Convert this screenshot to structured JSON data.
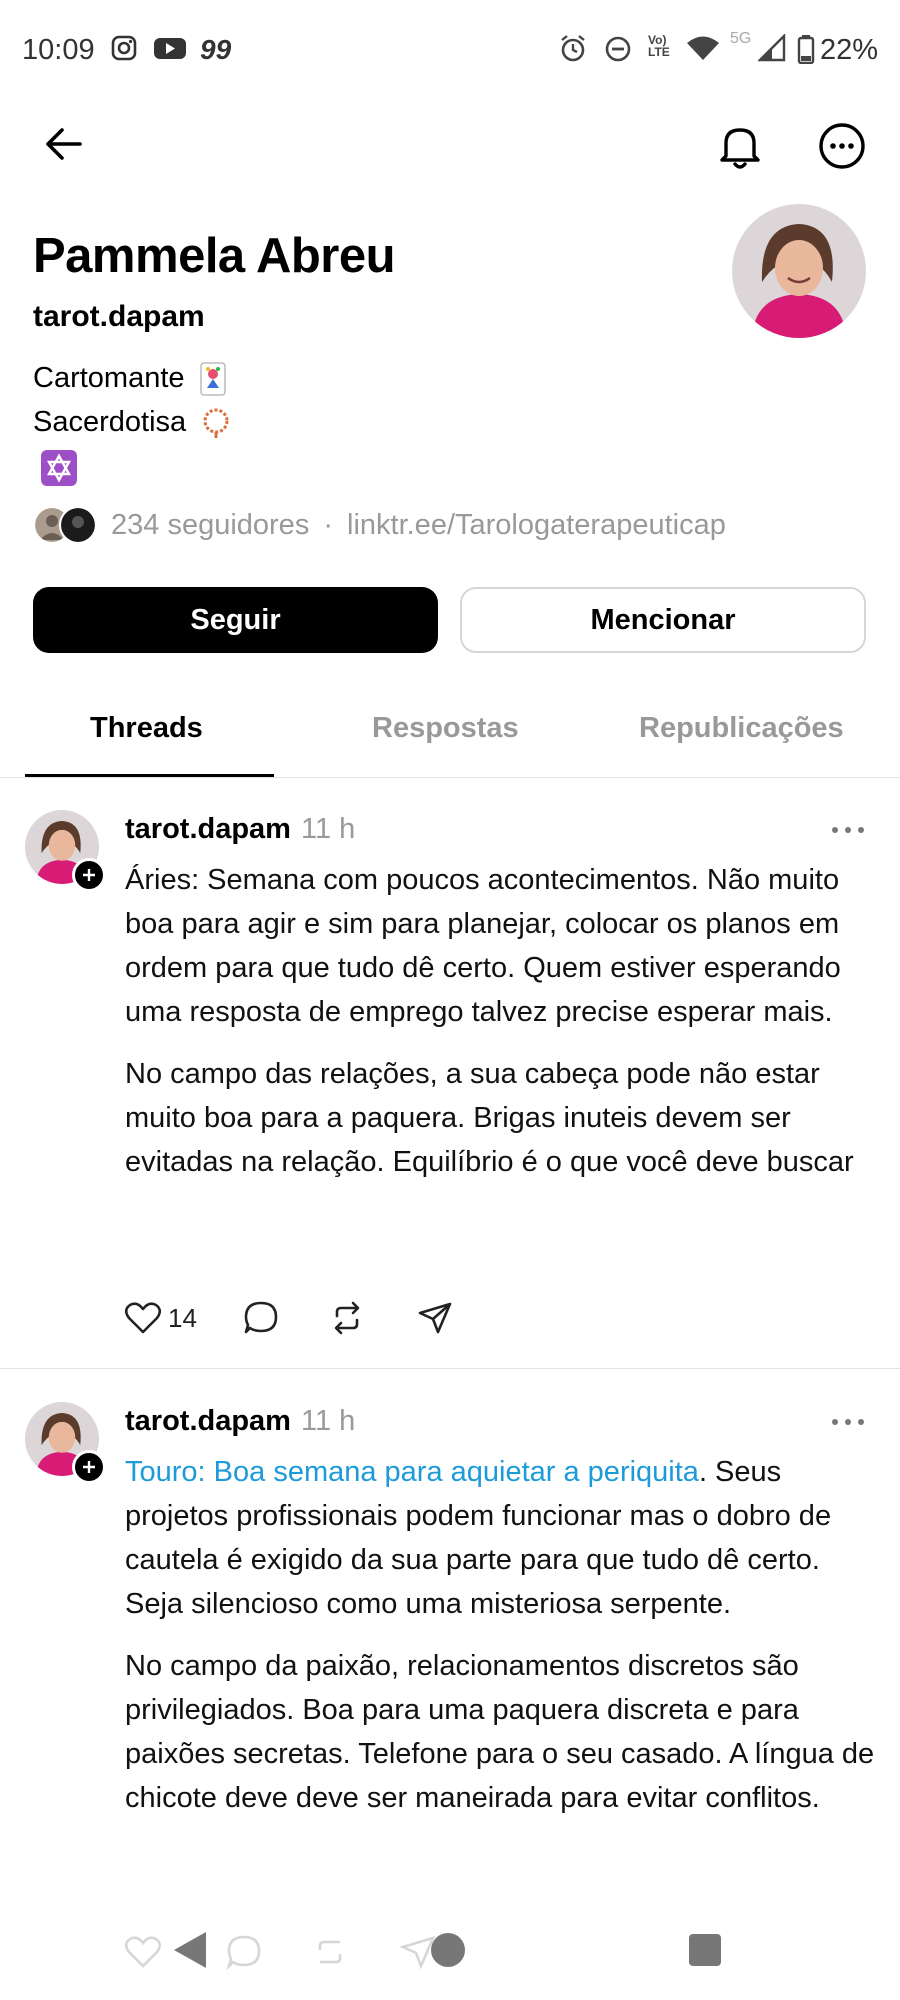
{
  "status_bar": {
    "time": "10:09",
    "notif_count": "99",
    "network": "5G",
    "battery": "22%"
  },
  "profile": {
    "name": "Pammela Abreu",
    "handle": "tarot.dapam",
    "bio_lines": [
      "Cartomante",
      "Sacerdotisa"
    ],
    "followers": "234 seguidores",
    "separator": "·",
    "link": "linktr.ee/Tarologaterapeuticap"
  },
  "buttons": {
    "follow": "Seguir",
    "mention": "Mencionar"
  },
  "tabs": [
    "Threads",
    "Respostas",
    "Republicações"
  ],
  "posts": [
    {
      "user": "tarot.dapam",
      "time": "11 h",
      "paragraph1": "Áries: Semana com poucos acontecimentos. Não muito boa para agir e sim para planejar, colocar os planos em ordem para que tudo dê certo. Quem estiver esperando uma resposta de emprego talvez precise esperar mais.",
      "paragraph2": "No campo das relações, a sua cabeça pode não estar muito boa para a paquera. Brigas inuteis devem ser evitadas na relação. Equilíbrio é o que você deve buscar",
      "likes": "14"
    },
    {
      "user": "tarot.dapam",
      "time": "11 h",
      "link_text": "Touro: Boa semana para aquietar a periquita",
      "paragraph1_rest": ". Seus projetos profissionais podem funcionar mas o dobro de cautela é exigido da sua parte para que tudo dê certo.  Seja silencioso como uma misteriosa serpente.",
      "paragraph2": "No campo da paixão, relacionamentos discretos são privilegiados. Boa para uma paquera discreta e para paixões secretas. Telefone para o seu casado. A língua de chicote deve deve ser maneirada para evitar conflitos."
    }
  ],
  "colors": {
    "link": "#1d9bd9",
    "muted": "#999999",
    "avatar_top": "#b01e6a"
  },
  "icons": [
    "back-arrow-icon",
    "bell-icon",
    "more-icon",
    "heart-icon",
    "comment-icon",
    "repost-icon",
    "share-icon"
  ]
}
